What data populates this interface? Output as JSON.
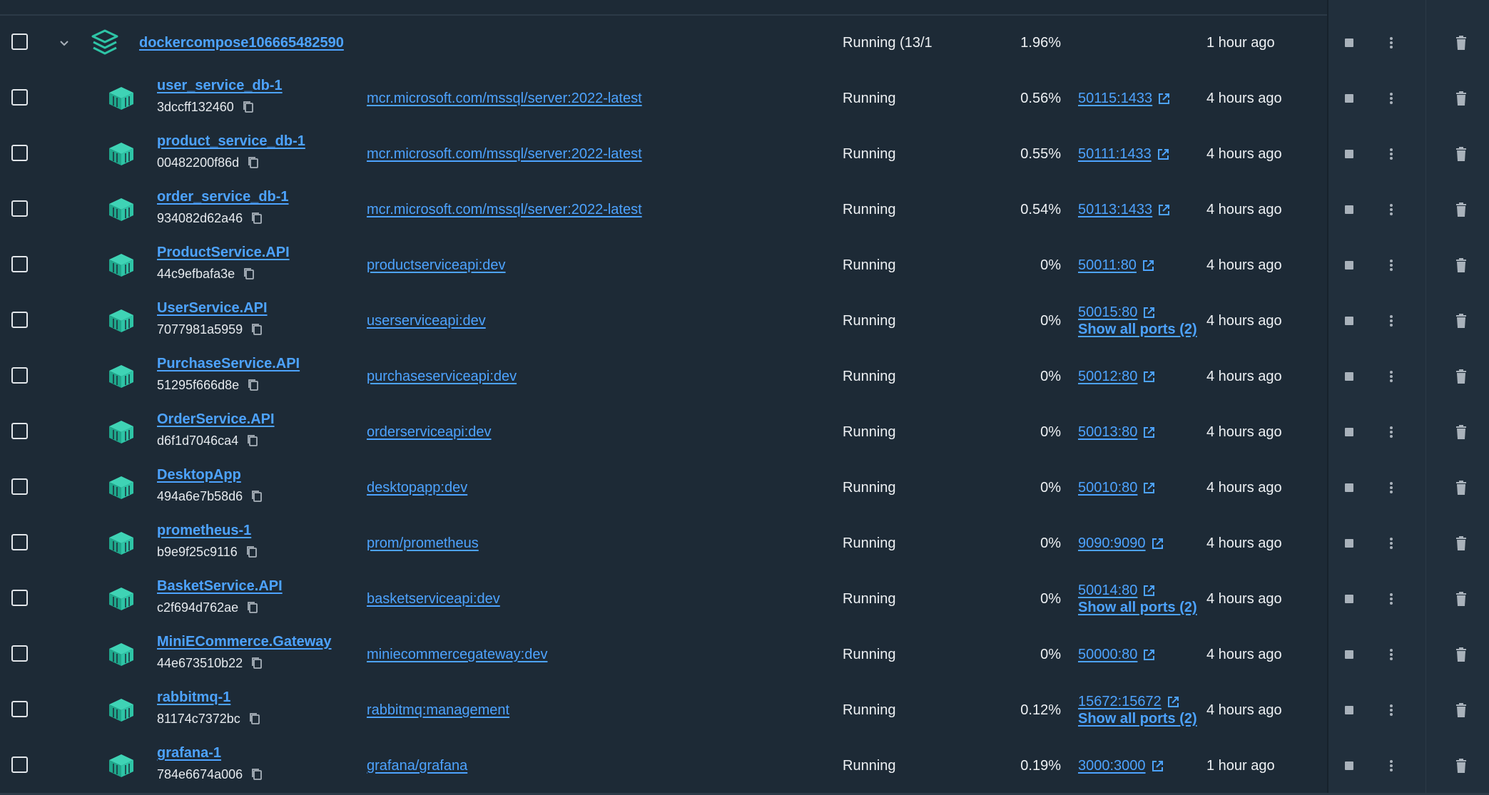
{
  "colors": {
    "background": "#1d2a36",
    "link": "#4da3ff",
    "container_icon": "#2ec4a6",
    "text": "#eef1f4"
  },
  "group": {
    "name": "dockercompose106665482590",
    "status": "Running (13/1",
    "cpu": "1.96%",
    "started": "1 hour ago",
    "icons": {
      "expand": "chevron-down-icon",
      "stack": "stack-layers-icon"
    }
  },
  "containers": [
    {
      "name": "user_service_db-1",
      "id": "3dccff132460",
      "image": "mcr.microsoft.com/mssql/server:2022-latest",
      "status": "Running",
      "cpu": "0.56%",
      "port": "50115:1433",
      "show_all": "",
      "started": "4 hours ago"
    },
    {
      "name": "product_service_db-1",
      "id": "00482200f86d",
      "image": "mcr.microsoft.com/mssql/server:2022-latest",
      "status": "Running",
      "cpu": "0.55%",
      "port": "50111:1433",
      "show_all": "",
      "started": "4 hours ago"
    },
    {
      "name": "order_service_db-1",
      "id": "934082d62a46",
      "image": "mcr.microsoft.com/mssql/server:2022-latest",
      "status": "Running",
      "cpu": "0.54%",
      "port": "50113:1433",
      "show_all": "",
      "started": "4 hours ago"
    },
    {
      "name": "ProductService.API",
      "id": "44c9efbafa3e",
      "image": "productserviceapi:dev",
      "status": "Running",
      "cpu": "0%",
      "port": "50011:80",
      "show_all": "",
      "started": "4 hours ago"
    },
    {
      "name": "UserService.API",
      "id": "7077981a5959",
      "image": "userserviceapi:dev",
      "status": "Running",
      "cpu": "0%",
      "port": "50015:80",
      "show_all": "Show all ports (2)",
      "started": "4 hours ago"
    },
    {
      "name": "PurchaseService.API",
      "id": "51295f666d8e",
      "image": "purchaseserviceapi:dev",
      "status": "Running",
      "cpu": "0%",
      "port": "50012:80",
      "show_all": "",
      "started": "4 hours ago"
    },
    {
      "name": "OrderService.API",
      "id": "d6f1d7046ca4",
      "image": "orderserviceapi:dev",
      "status": "Running",
      "cpu": "0%",
      "port": "50013:80",
      "show_all": "",
      "started": "4 hours ago"
    },
    {
      "name": "DesktopApp",
      "id": "494a6e7b58d6",
      "image": "desktopapp:dev",
      "status": "Running",
      "cpu": "0%",
      "port": "50010:80",
      "show_all": "",
      "started": "4 hours ago"
    },
    {
      "name": "prometheus-1",
      "id": "b9e9f25c9116",
      "image": "prom/prometheus",
      "status": "Running",
      "cpu": "0%",
      "port": "9090:9090",
      "show_all": "",
      "started": "4 hours ago"
    },
    {
      "name": "BasketService.API",
      "id": "c2f694d762ae",
      "image": "basketserviceapi:dev",
      "status": "Running",
      "cpu": "0%",
      "port": "50014:80",
      "show_all": "Show all ports (2)",
      "started": "4 hours ago"
    },
    {
      "name": "MiniECommerce.Gateway",
      "id": "44e673510b22",
      "image": "miniecommercegateway:dev",
      "status": "Running",
      "cpu": "0%",
      "port": "50000:80",
      "show_all": "",
      "started": "4 hours ago"
    },
    {
      "name": "rabbitmq-1",
      "id": "81174c7372bc",
      "image": "rabbitmq:management",
      "status": "Running",
      "cpu": "0.12%",
      "port": "15672:15672",
      "show_all": "Show all ports (2)",
      "started": "4 hours ago"
    },
    {
      "name": "grafana-1",
      "id": "784e6674a006",
      "image": "grafana/grafana",
      "status": "Running",
      "cpu": "0.19%",
      "port": "3000:3000",
      "show_all": "",
      "started": "1 hour ago"
    }
  ],
  "icons": {
    "container": "container-cube-icon",
    "copy": "copy-icon",
    "external": "external-link-icon",
    "stop": "stop-icon",
    "more": "more-vertical-icon",
    "delete": "trash-icon"
  }
}
